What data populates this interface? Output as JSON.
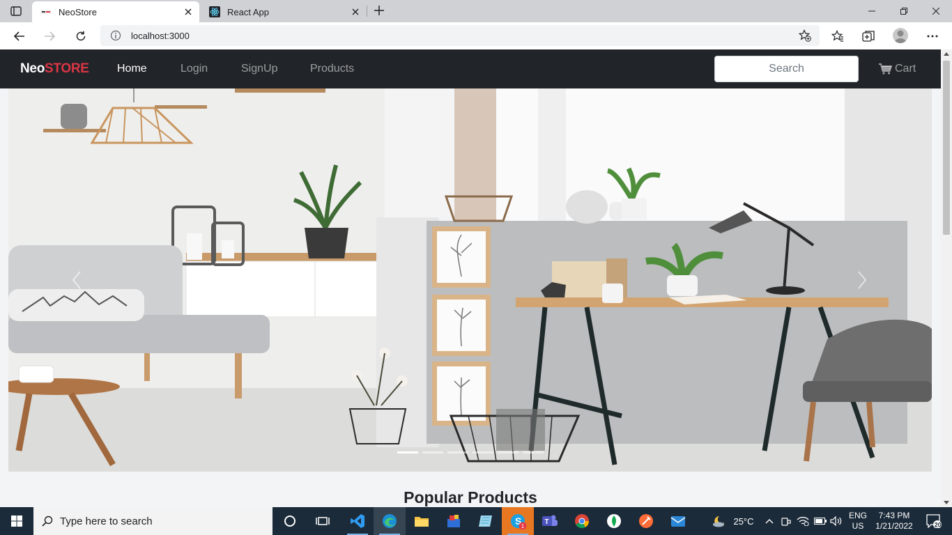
{
  "browser": {
    "tabs": [
      {
        "title": "NeoStore",
        "active": true
      },
      {
        "title": "React App",
        "active": false
      }
    ],
    "address": "localhost:3000"
  },
  "navbar": {
    "brand_neo": "Neo",
    "brand_store": "STORE",
    "links": [
      "Home",
      "Login",
      "SignUp",
      "Products"
    ],
    "active_link": "Home",
    "search_placeholder": "Search",
    "cart_label": "Cart"
  },
  "carousel": {
    "slide_count": 6,
    "active_slide": 1
  },
  "main": {
    "section_title": "Popular Products"
  },
  "taskbar": {
    "search_placeholder": "Type here to search",
    "weather": "25°C",
    "lang_line1": "ENG",
    "lang_line2": "US",
    "time": "7:43 PM",
    "date": "1/21/2022",
    "notification_count": "20",
    "skype_badge": "1"
  },
  "colors": {
    "navbar_bg": "#212529",
    "brand_accent": "#dc3545",
    "taskbar_bg": "#1c2b3a"
  }
}
